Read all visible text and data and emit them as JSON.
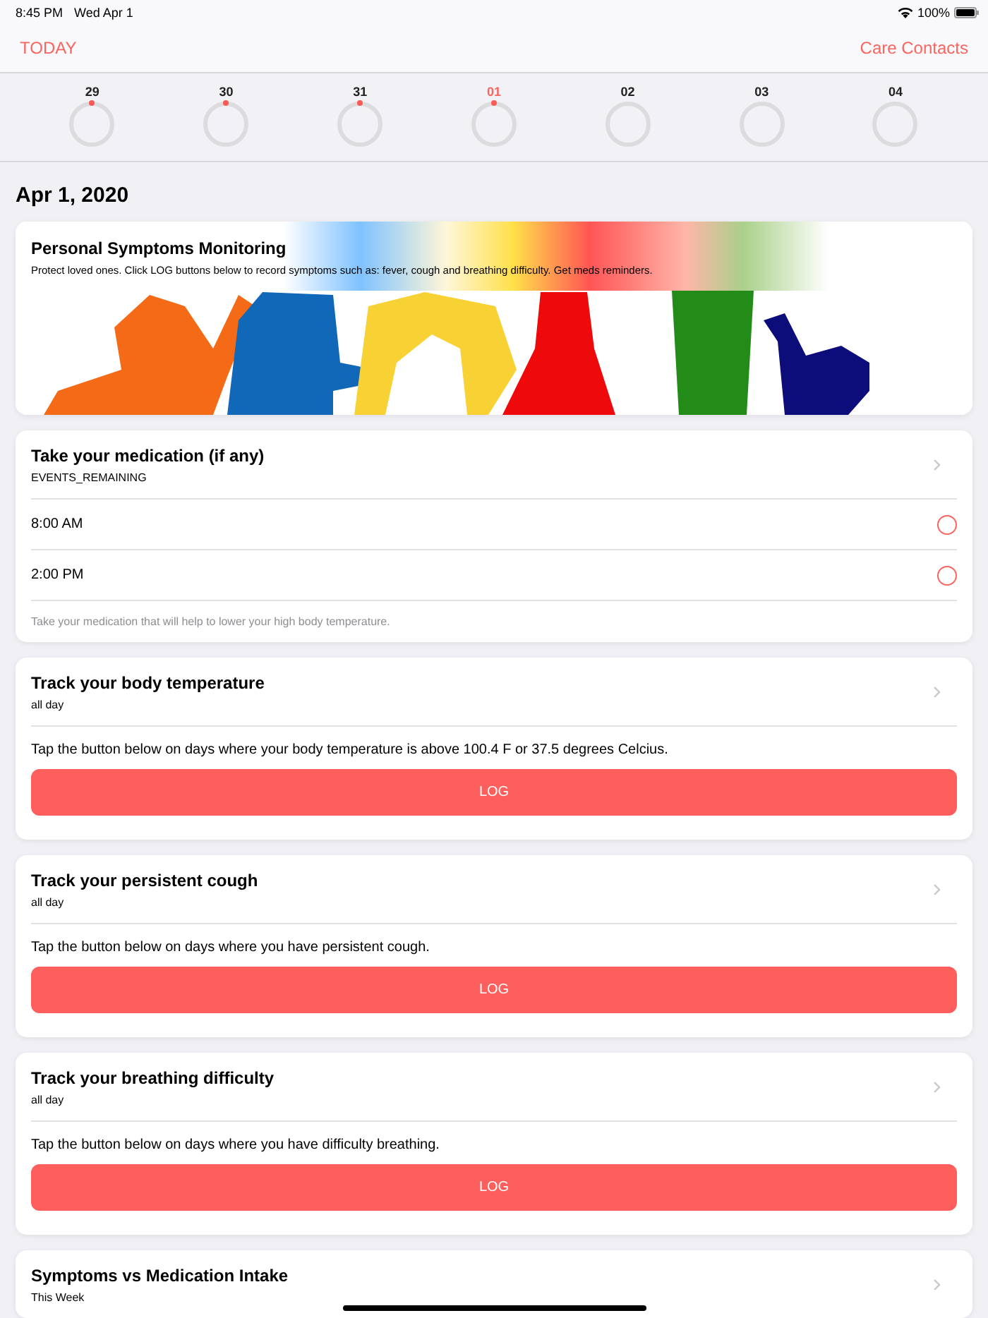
{
  "status_bar": {
    "time": "8:45 PM",
    "date": "Wed Apr 1",
    "battery": "100%"
  },
  "nav": {
    "left": "TODAY",
    "right": "Care Contacts"
  },
  "week": [
    {
      "label": "29",
      "selected": false,
      "marked": true
    },
    {
      "label": "30",
      "selected": false,
      "marked": true
    },
    {
      "label": "31",
      "selected": false,
      "marked": true
    },
    {
      "label": "01",
      "selected": true,
      "marked": true
    },
    {
      "label": "02",
      "selected": false,
      "marked": false
    },
    {
      "label": "03",
      "selected": false,
      "marked": false
    },
    {
      "label": "04",
      "selected": false,
      "marked": false
    }
  ],
  "date_heading": "Apr 1, 2020",
  "banner": {
    "title": "Personal Symptoms Monitoring",
    "text": "Protect loved ones. Click LOG buttons below to record symptoms such as: fever, cough and breathing difficulty. Get meds reminders.",
    "kind": "picture"
  },
  "cards": [
    {
      "kind": "checklist",
      "title": "Take your medication (if any)",
      "subtitle": "EVENTS_REMAINING",
      "items": [
        {
          "label": "8:00 AM",
          "checked": false
        },
        {
          "label": "2:00 PM",
          "checked": false
        }
      ],
      "note": "Take your medication that will help to lower your high body temperature."
    },
    {
      "kind": "log",
      "title": "Track your body temperature",
      "subtitle": "all day",
      "instructions": "Tap the button below on days where your body temperature is above 100.4 F or 37.5 degrees Celcius.",
      "button": "LOG"
    },
    {
      "kind": "log",
      "title": "Track your persistent cough",
      "subtitle": "all day",
      "instructions": "Tap the button below on days where you have persistent cough.",
      "button": "LOG"
    },
    {
      "kind": "log",
      "title": "Track your breathing difficulty",
      "subtitle": "all day",
      "instructions": "Tap the button below on days where you have difficulty breathing.",
      "button": "LOG"
    },
    {
      "kind": "chart",
      "title": "Symptoms vs Medication Intake",
      "subtitle": "This Week"
    }
  ]
}
